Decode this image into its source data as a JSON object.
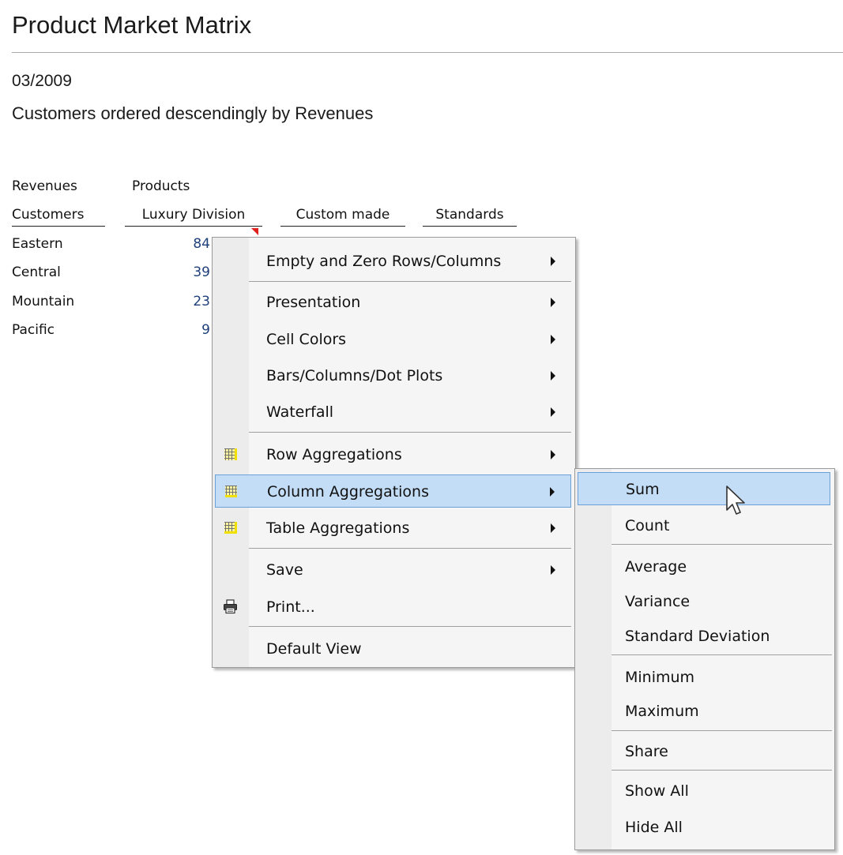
{
  "report": {
    "title": "Product Market Matrix",
    "period": "03/2009",
    "subtitle": "Customers ordered descendingly by Revenues"
  },
  "matrix": {
    "measure": "Revenues",
    "column_dimension": "Products",
    "row_dimension": "Customers",
    "columns": [
      "Luxury Division",
      "Custom made",
      "Standards"
    ],
    "rows": [
      {
        "label": "Eastern",
        "value": "84"
      },
      {
        "label": "Central",
        "value": "39"
      },
      {
        "label": "Mountain",
        "value": "23"
      },
      {
        "label": "Pacific",
        "value": "9"
      }
    ]
  },
  "context_menu": {
    "items": [
      {
        "label": "Empty and Zero Rows/Columns",
        "submenu": true
      },
      {
        "label": "Presentation",
        "submenu": true
      },
      {
        "label": "Cell Colors",
        "submenu": true
      },
      {
        "label": "Bars/Columns/Dot Plots",
        "submenu": true
      },
      {
        "label": "Waterfall",
        "submenu": true
      },
      {
        "label": "Row Aggregations",
        "submenu": true,
        "icon": "grid-icon"
      },
      {
        "label": "Column Aggregations",
        "submenu": true,
        "icon": "grid-icon",
        "highlighted": true
      },
      {
        "label": "Table Aggregations",
        "submenu": true,
        "icon": "grid-icon"
      },
      {
        "label": "Save",
        "submenu": true
      },
      {
        "label": "Print...",
        "icon": "printer-icon"
      },
      {
        "label": "Default View"
      }
    ]
  },
  "submenu": {
    "parent": "Column Aggregations",
    "items": [
      {
        "label": "Sum",
        "highlighted": true
      },
      {
        "label": "Count"
      },
      {
        "label": "Average"
      },
      {
        "label": "Variance"
      },
      {
        "label": "Standard Deviation"
      },
      {
        "label": "Minimum"
      },
      {
        "label": "Maximum"
      },
      {
        "label": "Share"
      },
      {
        "label": "Show All"
      },
      {
        "label": "Hide All"
      }
    ]
  },
  "colors": {
    "highlight_fill": "#c4ddf6",
    "highlight_border": "#6ca0d8",
    "value_text": "#1f3f7a",
    "comment_marker": "#e0201c",
    "grid_icon_yellow": "#f0e000"
  },
  "icons": [
    "grid-icon",
    "printer-icon",
    "submenu-arrow-icon",
    "mouse-pointer-icon"
  ]
}
